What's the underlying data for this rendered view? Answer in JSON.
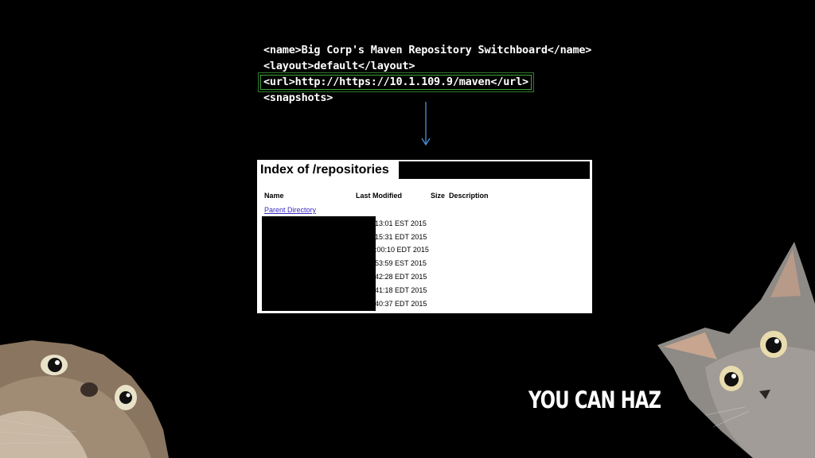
{
  "code_lines": [
    "<name>Big Corp's Maven Repository Switchboard</name>",
    "<layout>default</layout>",
    "<url>http://https://10.1.109.9/maven</url>",
    "<snapshots>"
  ],
  "listing": {
    "title": "Index of /repositories",
    "columns": {
      "name": "Name",
      "modified": "Last Modified",
      "size": "Size",
      "description": "Description"
    },
    "parent_link": "Parent Directory",
    "rows": [
      "13:01 EST 2015",
      "15:31 EDT 2015",
      ":00:10 EDT 2015",
      "53:59 EST 2015",
      "42:28 EDT 2015",
      "41:18 EDT 2015",
      "40:37 EDT 2015"
    ]
  },
  "caption": "YOU CAN HAZ",
  "colors": {
    "highlight": "#3fa43a",
    "arrow": "#4a90d9",
    "link": "#3a2bbf"
  }
}
